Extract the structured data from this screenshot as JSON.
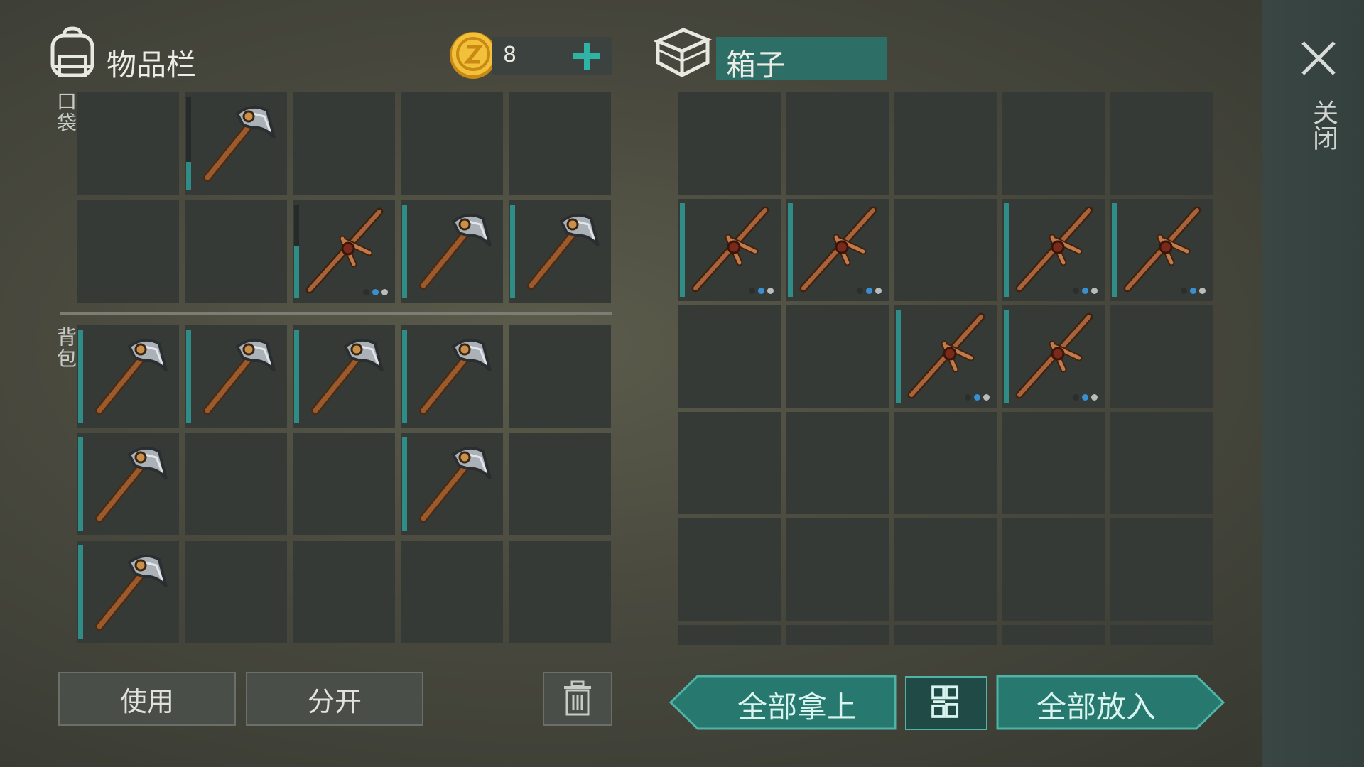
{
  "inventory": {
    "title": "物品栏",
    "pocket_label": "口袋",
    "backpack_label": "背包",
    "coin_count": "8",
    "pocket_slots": [
      {
        "item": null
      },
      {
        "item": "stone-pickaxe-icon",
        "durability": 0.3
      },
      {
        "item": null
      },
      {
        "item": null
      },
      {
        "item": null
      },
      {
        "item": null
      },
      {
        "item": null
      },
      {
        "item": "wooden-pickaxe-icon",
        "durability": 0.55,
        "dots": true
      },
      {
        "item": "stone-pickaxe-icon",
        "durability": 1.0
      },
      {
        "item": "stone-pickaxe-icon",
        "durability": 1.0
      }
    ],
    "backpack_slots": [
      {
        "item": "stone-pickaxe-icon",
        "durability": 1.0
      },
      {
        "item": "stone-pickaxe-icon",
        "durability": 1.0
      },
      {
        "item": "stone-pickaxe-icon",
        "durability": 1.0
      },
      {
        "item": "stone-pickaxe-icon",
        "durability": 1.0
      },
      {
        "item": null
      },
      {
        "item": "stone-pickaxe-icon",
        "durability": 1.0
      },
      {
        "item": null
      },
      {
        "item": null
      },
      {
        "item": "stone-pickaxe-icon",
        "durability": 1.0
      },
      {
        "item": null
      },
      {
        "item": "stone-pickaxe-icon",
        "durability": 1.0
      },
      {
        "item": null
      },
      {
        "item": null
      },
      {
        "item": null
      },
      {
        "item": null
      }
    ],
    "use_label": "使用",
    "split_label": "分开"
  },
  "box": {
    "title": "箱子",
    "slots": [
      {
        "item": null
      },
      {
        "item": null
      },
      {
        "item": null
      },
      {
        "item": null
      },
      {
        "item": null
      },
      {
        "item": "wooden-pickaxe-icon",
        "durability": 1.0,
        "dots": true
      },
      {
        "item": "wooden-pickaxe-icon",
        "durability": 1.0,
        "dots": true
      },
      {
        "item": null
      },
      {
        "item": "wooden-pickaxe-icon",
        "durability": 1.0,
        "dots": true
      },
      {
        "item": "wooden-pickaxe-icon",
        "durability": 1.0,
        "dots": true
      },
      {
        "item": null
      },
      {
        "item": null
      },
      {
        "item": "wooden-pickaxe-icon",
        "durability": 1.0,
        "dots": true
      },
      {
        "item": "wooden-pickaxe-icon",
        "durability": 1.0,
        "dots": true
      },
      {
        "item": null
      },
      {
        "item": null
      },
      {
        "item": null
      },
      {
        "item": null
      },
      {
        "item": null
      },
      {
        "item": null
      },
      {
        "item": null
      },
      {
        "item": null
      },
      {
        "item": null
      },
      {
        "item": null
      },
      {
        "item": null
      }
    ],
    "take_all_label": "全部拿上",
    "put_all_label": "全部放入"
  },
  "close_label": "关闭",
  "colors": {
    "accent_teal": "#2b7a72",
    "slot_bg": "#353a37",
    "durability": "#2f8c86"
  }
}
